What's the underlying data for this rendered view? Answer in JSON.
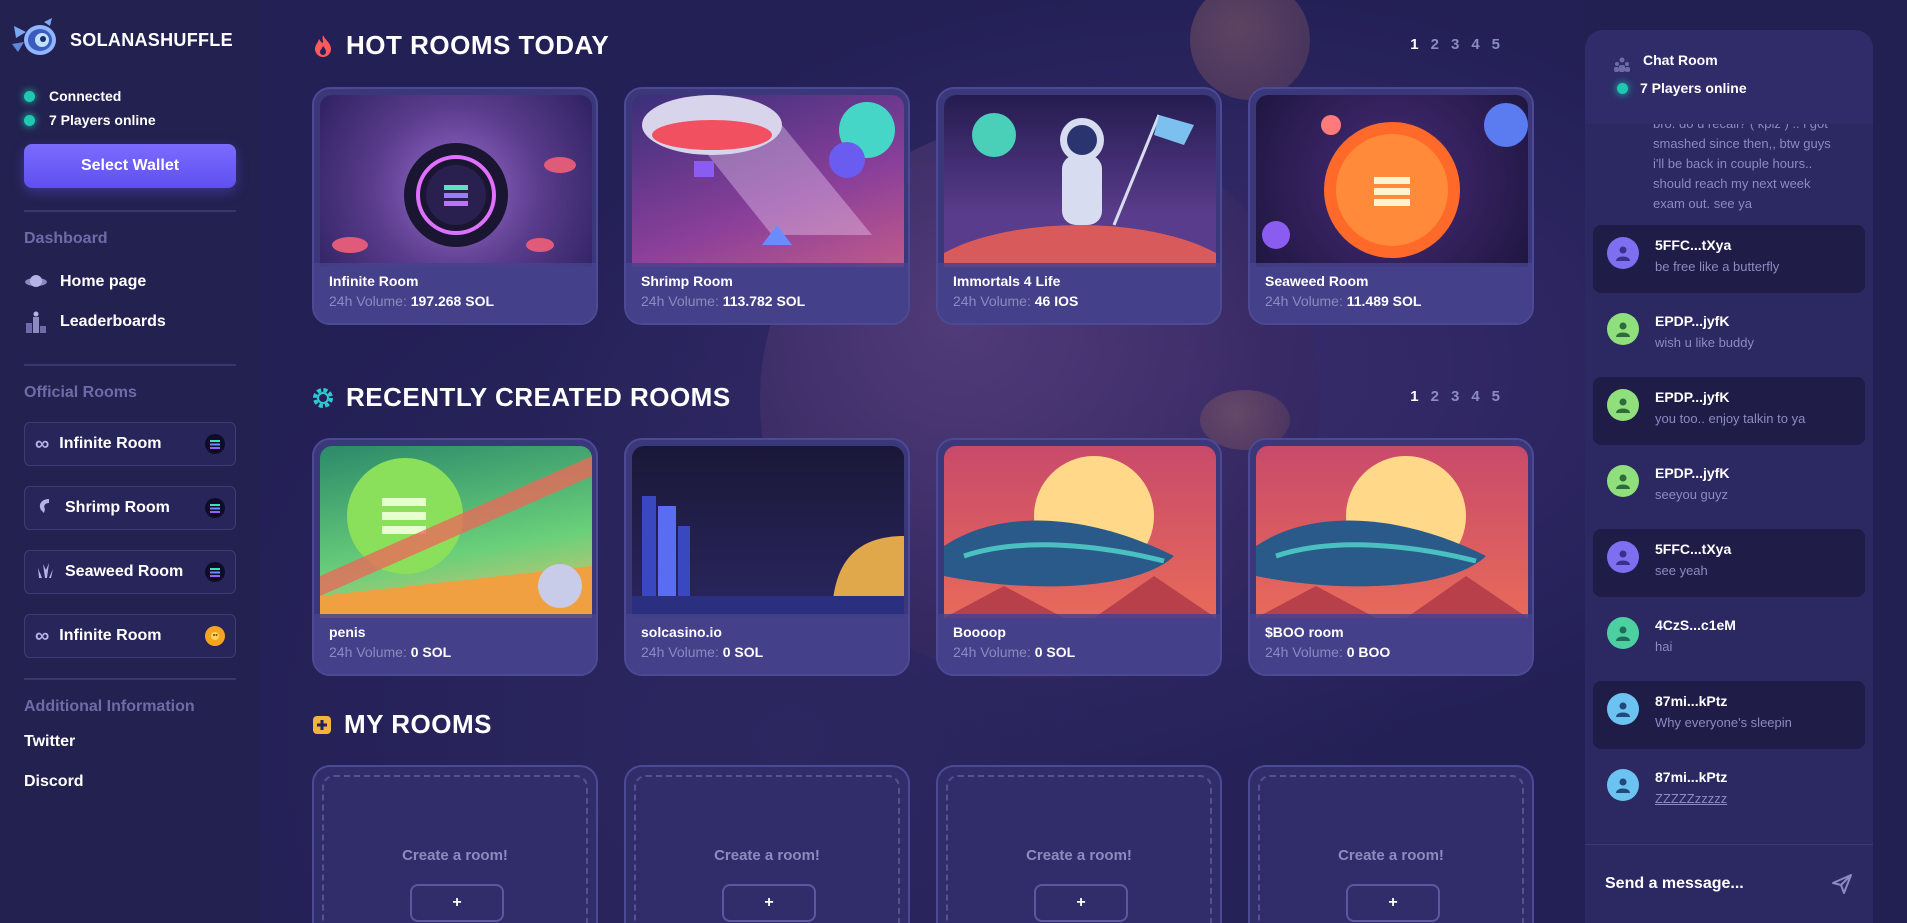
{
  "brand": {
    "name": "SOLANASHUFFLE"
  },
  "status": {
    "connected": "Connected",
    "players_online": "7 Players online"
  },
  "wallet": {
    "button": "Select Wallet"
  },
  "nav": {
    "dashboard_label": "Dashboard",
    "items": [
      {
        "label": "Home page",
        "icon": "planet-icon"
      },
      {
        "label": "Leaderboards",
        "icon": "podium-icon"
      }
    ]
  },
  "official_rooms": {
    "label": "Official Rooms",
    "items": [
      {
        "label": "Infinite Room",
        "icon": "infinity-icon",
        "token": "sol"
      },
      {
        "label": "Shrimp Room",
        "icon": "shrimp-icon",
        "token": "sol"
      },
      {
        "label": "Seaweed Room",
        "icon": "seaweed-icon",
        "token": "sol"
      },
      {
        "label": "Infinite Room",
        "icon": "infinity-icon",
        "token": "boo"
      }
    ]
  },
  "additional": {
    "label": "Additional Information",
    "links": [
      "Twitter",
      "Discord"
    ]
  },
  "hot_rooms": {
    "title": "HOT ROOMS TODAY",
    "pages": [
      "1",
      "2",
      "3",
      "4",
      "5"
    ],
    "vol_label": "24h Volume:",
    "cards": [
      {
        "name": "Infinite Room",
        "volume": "197.268 SOL"
      },
      {
        "name": "Shrimp Room",
        "volume": "113.782 SOL"
      },
      {
        "name": "Immortals 4 Life",
        "volume": "46 IOS"
      },
      {
        "name": "Seaweed Room",
        "volume": "11.489 SOL"
      }
    ]
  },
  "recent_rooms": {
    "title": "RECENTLY CREATED ROOMS",
    "pages": [
      "1",
      "2",
      "3",
      "4",
      "5"
    ],
    "vol_label": "24h Volume:",
    "cards": [
      {
        "name": "penis",
        "volume": "0 SOL"
      },
      {
        "name": "solcasino.io",
        "volume": "0 SOL"
      },
      {
        "name": "Boooop",
        "volume": "0 SOL"
      },
      {
        "name": "$BOO room",
        "volume": "0 BOO"
      }
    ]
  },
  "my_rooms": {
    "title": "MY ROOMS",
    "create_text": "Create a room!",
    "plus": "+"
  },
  "chat": {
    "title": "Chat Room",
    "online": "7 Players online",
    "intro_text": "bro. do u recall? ( kpiz ) .. i got smashed since then,, btw guys i'll be back in couple hours.. should reach my next week exam out. see ya",
    "messages": [
      {
        "user": "5FFC...tXya",
        "text": "be free like a butterfly",
        "avatar": "purple",
        "dark": true
      },
      {
        "user": "EPDP...jyfK",
        "text": "wish u like buddy",
        "avatar": "green",
        "dark": false
      },
      {
        "user": "EPDP...jyfK",
        "text": "you too.. enjoy talkin to ya",
        "avatar": "green",
        "dark": true
      },
      {
        "user": "EPDP...jyfK",
        "text": "seeyou guyz",
        "avatar": "green",
        "dark": false
      },
      {
        "user": "5FFC...tXya",
        "text": "see yeah",
        "avatar": "purple",
        "dark": true
      },
      {
        "user": "4CzS...c1eM",
        "text": "hai",
        "avatar": "teal",
        "dark": false
      },
      {
        "user": "87mi...kPtz",
        "text": "Why everyone's sleepin",
        "avatar": "blue",
        "dark": true
      },
      {
        "user": "87mi...kPtz",
        "text": "ZZZZZzzzzz",
        "avatar": "blue",
        "dark": false
      }
    ],
    "input_placeholder": "Send a message..."
  },
  "colors": {
    "accent": "#6b5cff",
    "online": "#1ec9b0",
    "bg": "#1d1b47"
  }
}
